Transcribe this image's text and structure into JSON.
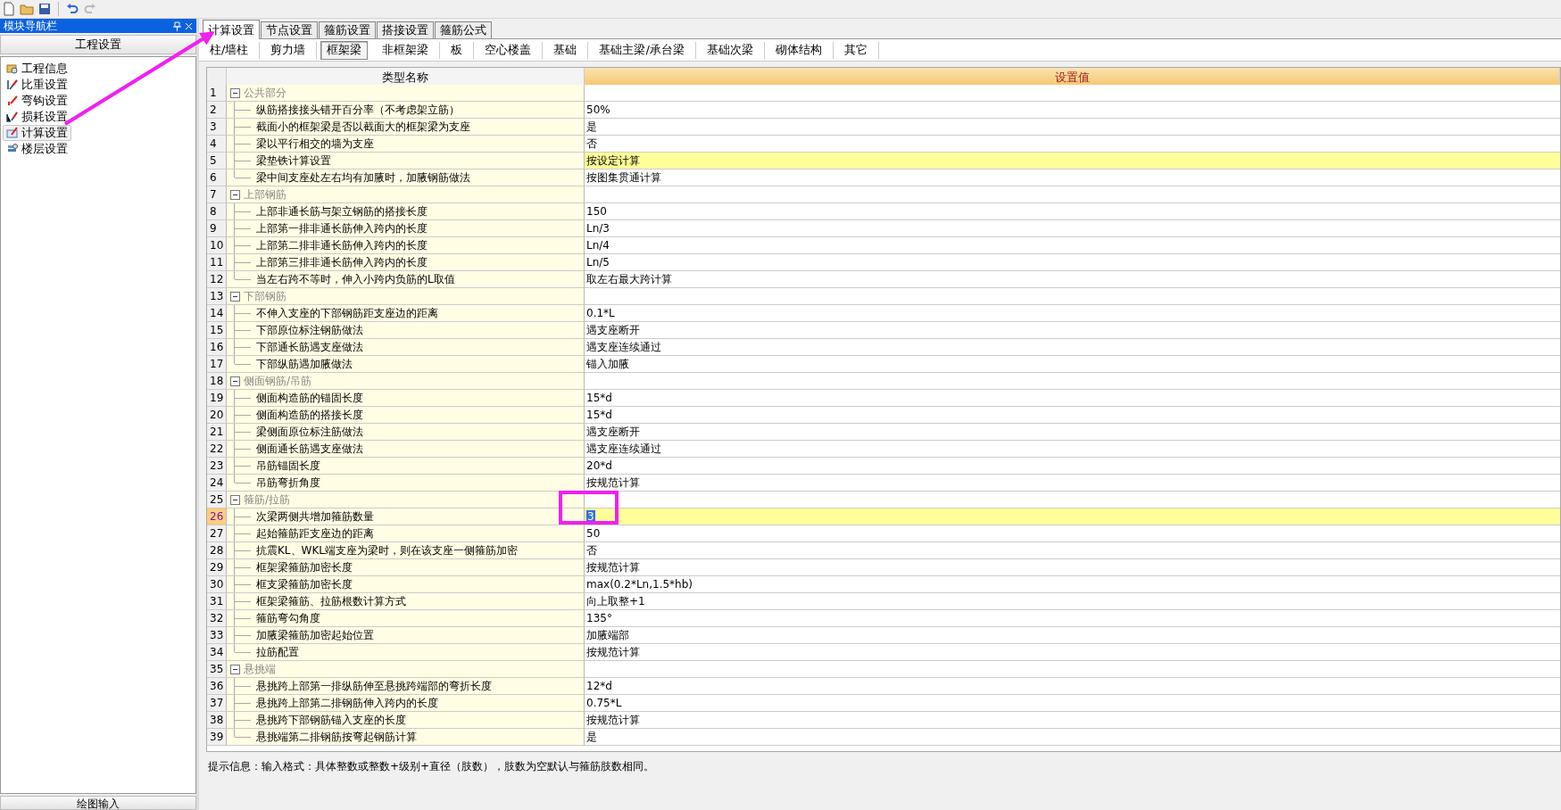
{
  "nav": {
    "title": "模块导航栏",
    "section": "工程设置",
    "footer": "绘图输入",
    "items": [
      {
        "label": "工程信息",
        "selected": false
      },
      {
        "label": "比重设置",
        "selected": false
      },
      {
        "label": "弯钩设置",
        "selected": false
      },
      {
        "label": "损耗设置",
        "selected": false
      },
      {
        "label": "计算设置",
        "selected": true
      },
      {
        "label": "楼层设置",
        "selected": false
      }
    ]
  },
  "tabs": [
    {
      "label": "计算设置",
      "selected": true
    },
    {
      "label": "节点设置",
      "selected": false
    },
    {
      "label": "箍筋设置",
      "selected": false
    },
    {
      "label": "搭接设置",
      "selected": false
    },
    {
      "label": "箍筋公式",
      "selected": false
    }
  ],
  "subtabs": [
    {
      "label": "柱/墙柱",
      "selected": false
    },
    {
      "label": "剪力墙",
      "selected": false
    },
    {
      "label": "框架梁",
      "selected": true
    },
    {
      "label": "非框架梁",
      "selected": false
    },
    {
      "label": "板",
      "selected": false
    },
    {
      "label": "空心楼盖",
      "selected": false
    },
    {
      "label": "基础",
      "selected": false
    },
    {
      "label": "基础主梁/承台梁",
      "selected": false
    },
    {
      "label": "基础次梁",
      "selected": false
    },
    {
      "label": "砌体结构",
      "selected": false
    },
    {
      "label": "其它",
      "selected": false
    }
  ],
  "table": {
    "columns": [
      "类型名称",
      "设置值"
    ],
    "groups": [
      {
        "number": "1",
        "label": "公共部分",
        "expanded": true,
        "children": [
          {
            "number": "2",
            "name": "纵筋搭接接头错开百分率（不考虑架立筋）",
            "value": "50%",
            "highlighted": false,
            "selected": false
          },
          {
            "number": "3",
            "name": "截面小的框架梁是否以截面大的框架梁为支座",
            "value": "是",
            "highlighted": false,
            "selected": false
          },
          {
            "number": "4",
            "name": "梁以平行相交的墙为支座",
            "value": "否",
            "highlighted": false,
            "selected": false
          },
          {
            "number": "5",
            "name": "梁垫铁计算设置",
            "value": "按设定计算",
            "highlighted": true,
            "selected": false
          },
          {
            "number": "6",
            "name": "梁中间支座处左右均有加腋时，加腋钢筋做法",
            "value": "按图集贯通计算",
            "highlighted": false,
            "selected": false
          }
        ]
      },
      {
        "number": "7",
        "label": "上部钢筋",
        "expanded": true,
        "children": [
          {
            "number": "8",
            "name": "上部非通长筋与架立钢筋的搭接长度",
            "value": "150",
            "highlighted": false,
            "selected": false
          },
          {
            "number": "9",
            "name": "上部第一排非通长筋伸入跨内的长度",
            "value": "Ln/3",
            "highlighted": false,
            "selected": false
          },
          {
            "number": "10",
            "name": "上部第二排非通长筋伸入跨内的长度",
            "value": "Ln/4",
            "highlighted": false,
            "selected": false
          },
          {
            "number": "11",
            "name": "上部第三排非通长筋伸入跨内的长度",
            "value": "Ln/5",
            "highlighted": false,
            "selected": false
          },
          {
            "number": "12",
            "name": "当左右跨不等时，伸入小跨内负筋的L取值",
            "value": "取左右最大跨计算",
            "highlighted": false,
            "selected": false
          }
        ]
      },
      {
        "number": "13",
        "label": "下部钢筋",
        "expanded": true,
        "children": [
          {
            "number": "14",
            "name": "不伸入支座的下部钢筋距支座边的距离",
            "value": "0.1*L",
            "highlighted": false,
            "selected": false
          },
          {
            "number": "15",
            "name": "下部原位标注钢筋做法",
            "value": "遇支座断开",
            "highlighted": false,
            "selected": false
          },
          {
            "number": "16",
            "name": "下部通长筋遇支座做法",
            "value": "遇支座连续通过",
            "highlighted": false,
            "selected": false
          },
          {
            "number": "17",
            "name": "下部纵筋遇加腋做法",
            "value": "锚入加腋",
            "highlighted": false,
            "selected": false
          }
        ]
      },
      {
        "number": "18",
        "label": "侧面钢筋/吊筋",
        "expanded": true,
        "children": [
          {
            "number": "19",
            "name": "侧面构造筋的锚固长度",
            "value": "15*d",
            "highlighted": false,
            "selected": false
          },
          {
            "number": "20",
            "name": "侧面构造筋的搭接长度",
            "value": "15*d",
            "highlighted": false,
            "selected": false
          },
          {
            "number": "21",
            "name": "梁侧面原位标注筋做法",
            "value": "遇支座断开",
            "highlighted": false,
            "selected": false
          },
          {
            "number": "22",
            "name": "侧面通长筋遇支座做法",
            "value": "遇支座连续通过",
            "highlighted": false,
            "selected": false
          },
          {
            "number": "23",
            "name": "吊筋锚固长度",
            "value": "20*d",
            "highlighted": false,
            "selected": false
          },
          {
            "number": "24",
            "name": "吊筋弯折角度",
            "value": "按规范计算",
            "highlighted": false,
            "selected": false
          }
        ]
      },
      {
        "number": "25",
        "label": "箍筋/拉筋",
        "expanded": true,
        "children": [
          {
            "number": "26",
            "name": "次梁两侧共增加箍筋数量",
            "value": "3",
            "highlighted": true,
            "selected": true
          },
          {
            "number": "27",
            "name": "起始箍筋距支座边的距离",
            "value": "50",
            "highlighted": false,
            "selected": false
          },
          {
            "number": "28",
            "name": "抗震KL、WKL端支座为梁时，则在该支座一侧箍筋加密",
            "value": "否",
            "highlighted": false,
            "selected": false
          },
          {
            "number": "29",
            "name": "框架梁箍筋加密长度",
            "value": "按规范计算",
            "highlighted": false,
            "selected": false
          },
          {
            "number": "30",
            "name": "框支梁箍筋加密长度",
            "value": "max(0.2*Ln,1.5*hb)",
            "highlighted": false,
            "selected": false
          },
          {
            "number": "31",
            "name": "框架梁箍筋、拉筋根数计算方式",
            "value": "向上取整+1",
            "highlighted": false,
            "selected": false
          },
          {
            "number": "32",
            "name": "箍筋弯勾角度",
            "value": "135°",
            "highlighted": false,
            "selected": false
          },
          {
            "number": "33",
            "name": "加腋梁箍筋加密起始位置",
            "value": "加腋端部",
            "highlighted": false,
            "selected": false
          },
          {
            "number": "34",
            "name": "拉筋配置",
            "value": "按规范计算",
            "highlighted": false,
            "selected": false
          }
        ]
      },
      {
        "number": "35",
        "label": "悬挑端",
        "expanded": true,
        "children": [
          {
            "number": "36",
            "name": "悬挑跨上部第一排纵筋伸至悬挑跨端部的弯折长度",
            "value": "12*d",
            "highlighted": false,
            "selected": false
          },
          {
            "number": "37",
            "name": "悬挑跨上部第二排钢筋伸入跨内的长度",
            "value": "0.75*L",
            "highlighted": false,
            "selected": false
          },
          {
            "number": "38",
            "name": "悬挑跨下部钢筋锚入支座的长度",
            "value": "按规范计算",
            "highlighted": false,
            "selected": false
          },
          {
            "number": "39",
            "name": "悬挑端第二排钢筋按弯起钢筋计算",
            "value": "是",
            "highlighted": false,
            "selected": false
          }
        ]
      }
    ]
  },
  "hint": "提示信息：输入格式：具体整数或整数+级别+直径（肢数），肢数为空默认与箍筋肢数相同。"
}
